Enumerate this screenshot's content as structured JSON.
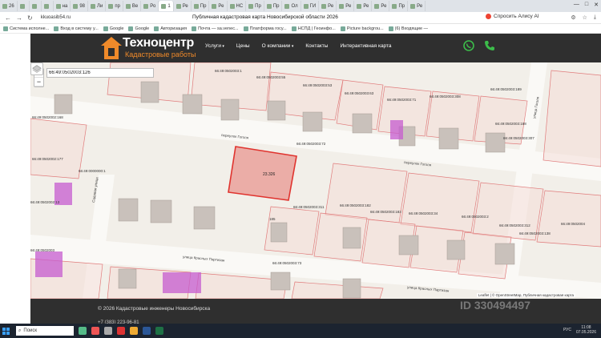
{
  "browser": {
    "tabs": [
      {
        "label": "26"
      },
      {
        "label": ""
      },
      {
        "label": ""
      },
      {
        "label": ""
      },
      {
        "label": "на"
      },
      {
        "label": "98"
      },
      {
        "label": "Ли"
      },
      {
        "label": "пр"
      },
      {
        "label": "Ве"
      },
      {
        "label": "Ро"
      },
      {
        "label": "1"
      },
      {
        "label": "Ре"
      },
      {
        "label": "Пр"
      },
      {
        "label": "Ре"
      },
      {
        "label": "НС"
      },
      {
        "label": "Пр"
      },
      {
        "label": "Пр"
      },
      {
        "label": "Ол"
      },
      {
        "label": "ГИ"
      },
      {
        "label": "Ре"
      },
      {
        "label": "Ре"
      },
      {
        "label": "Ре"
      },
      {
        "label": "Ре"
      },
      {
        "label": "Пр"
      },
      {
        "label": "Ре"
      }
    ],
    "url": "kkuoasib54.ru",
    "page_title": "Публичная кадастровая карта Новосибирской области 2026",
    "alisa_label": "Спросить Алису AI",
    "window_controls": [
      "—",
      "□",
      "✕"
    ],
    "bookmarks": [
      "Система исполне...",
      "Вход в систему у...",
      "Google",
      "Google",
      "Авторизация",
      "Почта — sa.venec...",
      "Платформа госу...",
      "НСПД | Геоинфо...",
      "Picture backgrou...",
      "(6) Входящие —"
    ]
  },
  "site": {
    "brand_name": "Техноцентр",
    "brand_sub": "Кадастровые работы",
    "brand_color": "#f08a2a",
    "menu": [
      {
        "label": "Услуги",
        "has_caret": true
      },
      {
        "label": "Цены",
        "has_caret": false
      },
      {
        "label": "О компании",
        "has_caret": true
      },
      {
        "label": "Контакты",
        "has_caret": false
      },
      {
        "label": "Интерактивная карта",
        "has_caret": false
      }
    ],
    "icons": [
      "whatsapp-icon",
      "phone-icon"
    ]
  },
  "map": {
    "search_value": "66:49:0502003:126",
    "zoom_in": "+",
    "zoom_out": "−",
    "selected_parcel_label": "23.326",
    "selected_color": "#e0342f",
    "parcel_labels": [
      "66:49:0502003:1",
      "66:49:0502003:55",
      "66:49:0502003:53",
      "66:49:0502003:63",
      "66:49:0502003:71",
      "66:49:0502003:308",
      "66:49:0502003:189",
      "66:49:0502002:168",
      "66:49:0502003:72",
      "66:49:0502003:188",
      "66:49:0502003:307",
      "66:49:0502002:177",
      "66:49:0000000:1",
      "66:49:0502002:13",
      "66:49:0502003:311",
      "66:49:0502003:182",
      "66:49:0502003:183",
      "66:49:0502003:34",
      "66:49:0502003:2",
      "66:49:0502003:312",
      "66:49:0502003:138",
      "66:49:0502004",
      "66:49:0502003:73",
      "66:49:0502003",
      "185"
    ],
    "street_labels": [
      "переулок Гоголя",
      "переулок Гоголя",
      "улица Гоголя",
      "улица Красных Партизан",
      "улица Красных Партизан",
      "Садовая улица"
    ],
    "attribution": "Leaflet | © OpenStreetMap, Публичная кадастровая карта"
  },
  "footer": {
    "copyright": "© 2026 Кадастровые инженеры Новосибирска",
    "phone": "+7 (383) 223-96-81",
    "watermark": "ID 330494497"
  },
  "taskbar": {
    "search_label": "Поиск",
    "language": "РУС",
    "time": "11:08",
    "date": "07.05.2026"
  }
}
